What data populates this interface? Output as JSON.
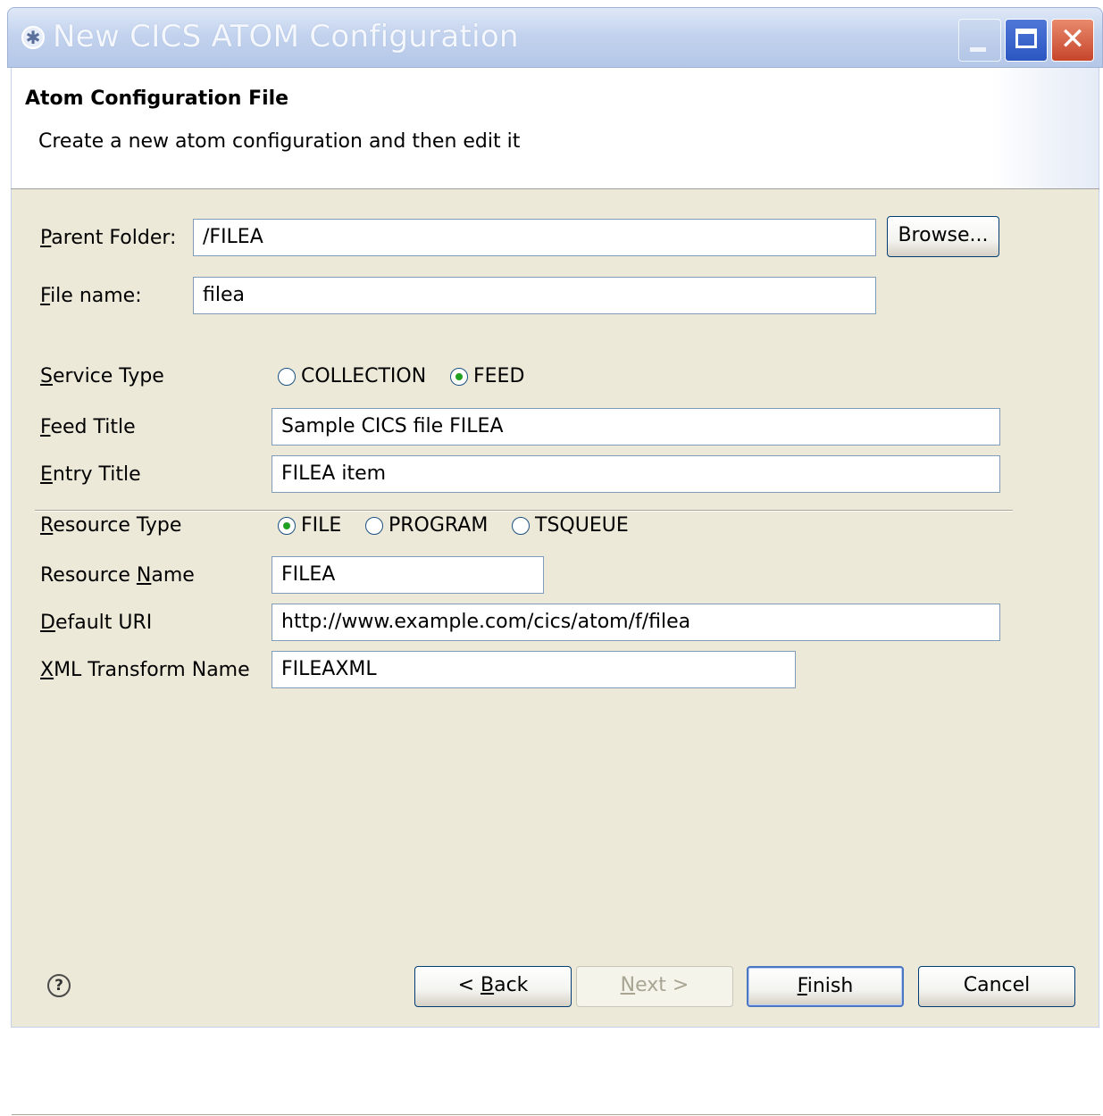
{
  "window": {
    "title": "New CICS ATOM Configuration",
    "icon": "cics-atom-icon",
    "controls": {
      "minimize_icon": "minimize-icon",
      "maximize_icon": "maximize-icon",
      "close_glyph": "✕"
    }
  },
  "header": {
    "title": "Atom Configuration File",
    "description": "Create a new atom configuration and then edit it"
  },
  "form": {
    "parent_folder": {
      "label_mnemonic": "P",
      "label_rest": "arent Folder:",
      "value": "/FILEA",
      "browse_label": "Browse..."
    },
    "file_name": {
      "label_mnemonic": "F",
      "label_rest": "ile name:",
      "value": "filea"
    },
    "service_type": {
      "label_mnemonic": "S",
      "label_rest": "ervice Type",
      "options": [
        {
          "label": "COLLECTION",
          "selected": false
        },
        {
          "label": "FEED",
          "selected": true
        }
      ]
    },
    "feed_title": {
      "label_mnemonic": "F",
      "label_rest": "eed Title",
      "value": "Sample CICS file FILEA"
    },
    "entry_title": {
      "label_mnemonic": "E",
      "label_rest": "ntry Title",
      "value": "FILEA item"
    },
    "resource_type": {
      "label_mnemonic": "R",
      "label_rest": "esource Type",
      "options": [
        {
          "label": "FILE",
          "selected": true
        },
        {
          "label": "PROGRAM",
          "selected": false
        },
        {
          "label": "TSQUEUE",
          "selected": false
        }
      ]
    },
    "resource_name": {
      "label_prefix": "Resource ",
      "label_mnemonic": "N",
      "label_rest": "ame",
      "value": "FILEA"
    },
    "default_uri": {
      "label_mnemonic": "D",
      "label_rest": "efault URI",
      "value": "http://www.example.com/cics/atom/f/filea"
    },
    "xml_transform": {
      "label_mnemonic": "X",
      "label_rest": "ML Transform Name",
      "value": "FILEAXML"
    }
  },
  "footer": {
    "help_glyph": "?",
    "back": {
      "prefix": "< ",
      "mnemonic": "B",
      "rest": "ack"
    },
    "next": {
      "mnemonic": "N",
      "rest": "ext >",
      "enabled": false
    },
    "finish": {
      "mnemonic": "F",
      "rest": "inish"
    },
    "cancel": {
      "label": "Cancel"
    }
  },
  "colors": {
    "panel_bg": "#ece9d8",
    "titlebar": "#c3d3ee",
    "radio_selected": "#21a121",
    "field_border": "#7f9db9"
  }
}
